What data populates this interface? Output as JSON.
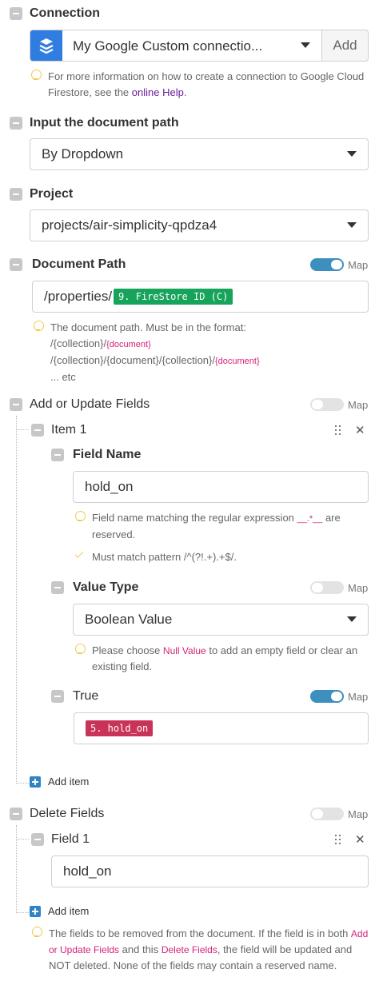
{
  "connection": {
    "label": "Connection",
    "value": "My Google Custom connectio...",
    "add_label": "Add",
    "hint_prefix": "For more information on how to create a connection to Google Cloud Firestore, see the ",
    "hint_link": "online Help",
    "hint_suffix": "."
  },
  "input_path": {
    "label": "Input the document path",
    "value": "By Dropdown"
  },
  "project": {
    "label": "Project",
    "value": "projects/air-simplicity-qpdza4"
  },
  "document_path": {
    "label": "Document Path",
    "map_label": "Map",
    "map_on": true,
    "prefix": "/properties/",
    "tag": "9. FireStore ID (C)",
    "hint_line1": "The document path. Must be in the format:",
    "hint_line2a": "/{collection}/",
    "hint_line2b": "{document}",
    "hint_line3a": "/{collection}/{document}/{collection}/",
    "hint_line3b": "{document}",
    "hint_line4": "... etc"
  },
  "add_update": {
    "label": "Add or Update Fields",
    "map_label": "Map",
    "map_on": false,
    "item_label": "Item 1",
    "field_name": {
      "label": "Field Name",
      "value": "hold_on",
      "hint_a": "Field name matching the regular expression ",
      "hint_code": "__.*__",
      "hint_b": " are reserved.",
      "pattern": "Must match pattern /^(?!.+).+$/."
    },
    "value_type": {
      "label": "Value Type",
      "map_label": "Map",
      "map_on": false,
      "value": "Boolean Value",
      "hint_a": "Please choose ",
      "hint_code": "Null Value",
      "hint_b": " to add an empty field or clear an existing field."
    },
    "true_field": {
      "label": "True",
      "map_label": "Map",
      "map_on": true,
      "tag": "5. hold_on"
    },
    "add_item": "Add item"
  },
  "delete_fields": {
    "label": "Delete Fields",
    "map_label": "Map",
    "map_on": false,
    "field_label": "Field 1",
    "value": "hold_on",
    "add_item": "Add item",
    "hint_a": "The fields to be removed from the document. If the field is in both ",
    "hint_code1": "Add or Update Fields",
    "hint_b": " and this ",
    "hint_code2": "Delete Fields",
    "hint_c": ", the field will be updated and NOT deleted. None of the fields may contain a reserved name."
  },
  "colors": {
    "accent": "#3d8fbd",
    "tag_green": "#16a35a",
    "tag_red": "#c9335a",
    "link": "#6a1b9a",
    "code_pink": "#d4237a",
    "connection_icon_bg": "#2f7de1"
  }
}
